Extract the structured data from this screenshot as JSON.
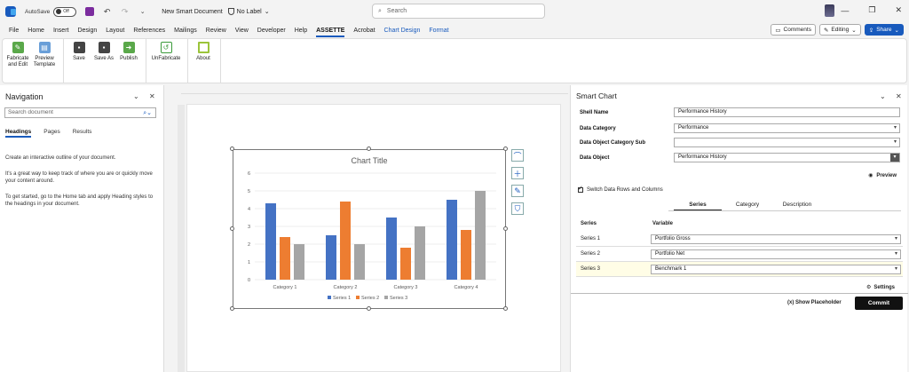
{
  "titlebar": {
    "autosave_label": "AutoSave",
    "autosave_state": "Off",
    "doc_title": "New Smart Document",
    "label_status": "No Label",
    "search_placeholder": "Search"
  },
  "menu": {
    "tabs": [
      "File",
      "Home",
      "Insert",
      "Design",
      "Layout",
      "References",
      "Mailings",
      "Review",
      "View",
      "Developer",
      "Help",
      "ASSETTE",
      "Acrobat",
      "Chart Design",
      "Format"
    ],
    "active_tab": "ASSETTE",
    "comments_label": "Comments",
    "editing_label": "Editing",
    "share_label": "Share"
  },
  "ribbon": {
    "fabricate": "Fabricate and Edit",
    "preview_template": "Preview Template",
    "save": "Save",
    "save_as": "Save As",
    "publish": "Publish",
    "unfabricate": "UnFabricate",
    "about": "About"
  },
  "nav": {
    "title": "Navigation",
    "search_placeholder": "Search document",
    "tabs": [
      "Headings",
      "Pages",
      "Results"
    ],
    "para1": "Create an interactive outline of your document.",
    "para2": "It's a great way to keep track of where you are or quickly move your content around.",
    "para3": "To get started, go to the Home tab and apply Heading styles to the headings in your document."
  },
  "chart_data": {
    "type": "bar",
    "title": "Chart Title",
    "categories": [
      "Category 1",
      "Category 2",
      "Category 3",
      "Category 4"
    ],
    "series": [
      {
        "name": "Series 1",
        "color": "#4472c4",
        "values": [
          4.3,
          2.5,
          3.5,
          4.5
        ]
      },
      {
        "name": "Series 2",
        "color": "#ed7d31",
        "values": [
          2.4,
          4.4,
          1.8,
          2.8
        ]
      },
      {
        "name": "Series 3",
        "color": "#a5a5a5",
        "values": [
          2,
          2,
          3,
          5
        ]
      }
    ],
    "ylim": [
      0,
      6
    ],
    "yticks": [
      "0",
      "1",
      "2",
      "3",
      "4",
      "5",
      "6"
    ],
    "grid": true,
    "legend": "bottom"
  },
  "smart_chart": {
    "title": "Smart Chart",
    "shell_name_label": "Shell Name",
    "shell_name_value": "Performance History",
    "data_category_label": "Data Category",
    "data_category_value": "Performance",
    "data_object_sub_label": "Data Object Category Sub",
    "data_object_sub_value": "",
    "data_object_label": "Data Object",
    "data_object_value": "Performance History",
    "preview_label": "Preview",
    "switch_label": "Switch Data Rows and Columns",
    "tabs": [
      "Series",
      "Category",
      "Description"
    ],
    "col_series": "Series",
    "col_variable": "Variable",
    "rows": [
      {
        "series": "Series 1",
        "variable": "Portfolio Gross"
      },
      {
        "series": "Series 2",
        "variable": "Portfolio Net"
      },
      {
        "series": "Series 3",
        "variable": "Benchmark 1"
      }
    ],
    "settings_label": "Settings",
    "show_placeholder_label": "Show Placeholder",
    "commit_label": "Commit"
  }
}
